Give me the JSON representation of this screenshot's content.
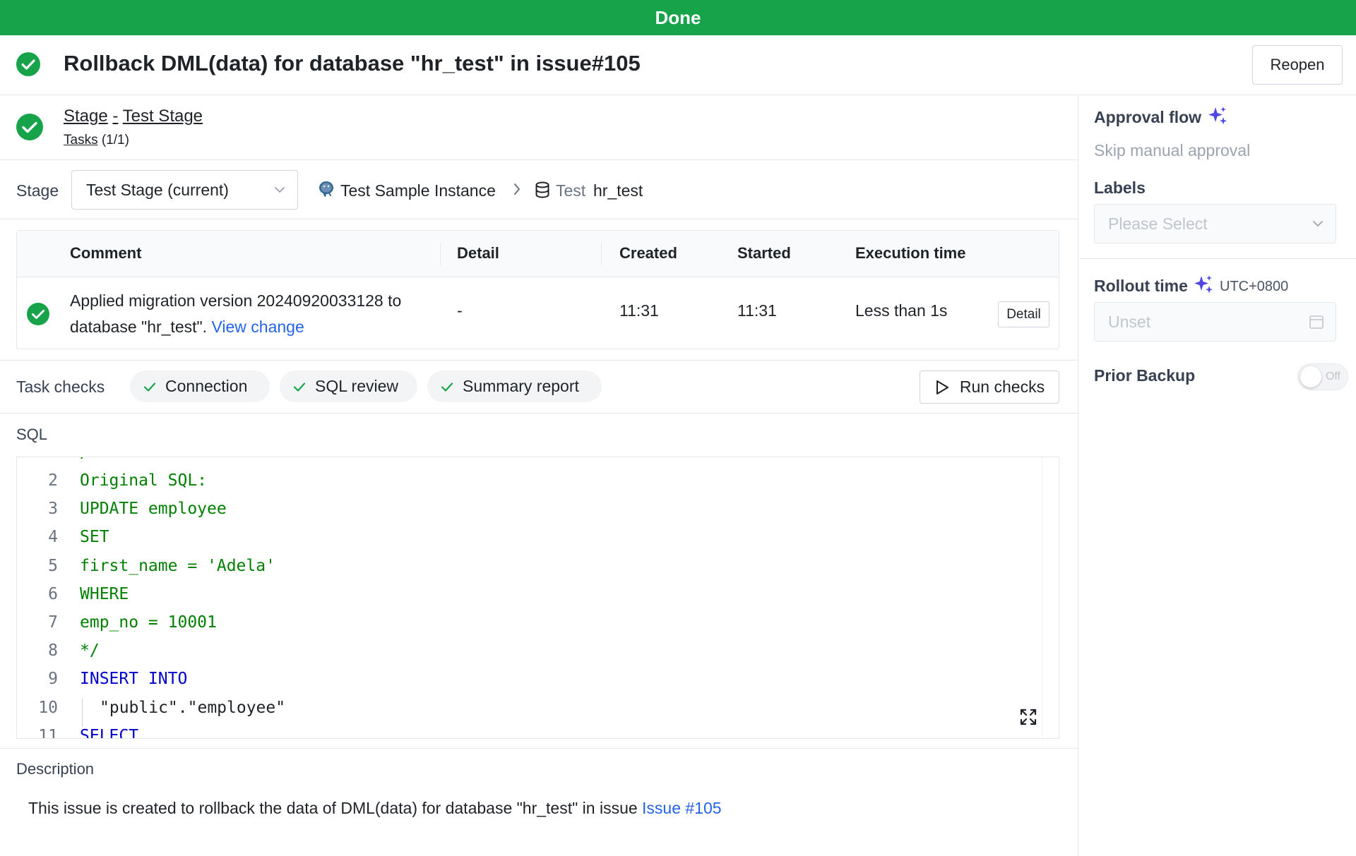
{
  "banner": {
    "status": "Done"
  },
  "header": {
    "title": "Rollback DML(data) for database \"hr_test\" in issue#105",
    "reopen_label": "Reopen"
  },
  "stage": {
    "stage_word": "Stage",
    "separator": "-",
    "stage_name": "Test Stage",
    "tasks_label": "Tasks",
    "tasks_count": "(1/1)"
  },
  "selector": {
    "label": "Stage",
    "selected": "Test Stage (current)",
    "instance": "Test Sample Instance",
    "db_env": "Test",
    "db_name": "hr_test"
  },
  "task_table": {
    "columns": [
      "Comment",
      "Detail",
      "Created",
      "Started",
      "Execution time"
    ],
    "rows": [
      {
        "comment_text": "Applied migration version 20240920033128 to database \"hr_test\".",
        "comment_link": "View change",
        "detail": "-",
        "created": "11:31",
        "started": "11:31",
        "execution_time": "Less than 1s",
        "detail_button": "Detail"
      }
    ]
  },
  "task_checks": {
    "label": "Task checks",
    "items": [
      "Connection",
      "SQL review",
      "Summary report"
    ],
    "run_label": "Run checks"
  },
  "sql": {
    "label": "SQL",
    "lines": [
      {
        "n": "2",
        "text": "Original SQL:",
        "kind": "comment"
      },
      {
        "n": "3",
        "text": "UPDATE employee",
        "kind": "comment"
      },
      {
        "n": "4",
        "text": "SET",
        "kind": "comment"
      },
      {
        "n": "5",
        "text": "first_name = 'Adela'",
        "kind": "comment"
      },
      {
        "n": "6",
        "text": "WHERE",
        "kind": "comment"
      },
      {
        "n": "7",
        "text": "emp_no = 10001",
        "kind": "comment"
      },
      {
        "n": "8",
        "text": "*/",
        "kind": "comment"
      },
      {
        "n": "9",
        "text": "INSERT INTO",
        "kind": "kw"
      },
      {
        "n": "10",
        "text": "\"public\".\"employee\"",
        "kind": "plain"
      },
      {
        "n": "11",
        "text": "SELECT",
        "kind": "kw"
      }
    ]
  },
  "description": {
    "label": "Description",
    "text": "This issue is created to rollback the data of DML(data) for database \"hr_test\" in issue",
    "link": "Issue #105"
  },
  "sidebar": {
    "approval_title": "Approval flow",
    "approval_value": "Skip manual approval",
    "labels_title": "Labels",
    "labels_placeholder": "Please Select",
    "rollout_title": "Rollout time",
    "timezone": "UTC+0800",
    "rollout_placeholder": "Unset",
    "backup_title": "Prior Backup",
    "backup_toggle_text": "Off"
  },
  "colors": {
    "success": "#16a34a",
    "accent": "#4f46e5",
    "link": "#2563eb",
    "sql_comment": "#008000",
    "sql_keyword": "#0000cc"
  },
  "icons": {
    "status": "check-circle-icon",
    "instance": "postgres-elephant-icon",
    "database": "database-icon",
    "crumb": "chevron-right-icon",
    "sparkle": "sparkle-icon",
    "expand": "expand-icon",
    "calendar": "calendar-icon",
    "play": "play-icon"
  }
}
